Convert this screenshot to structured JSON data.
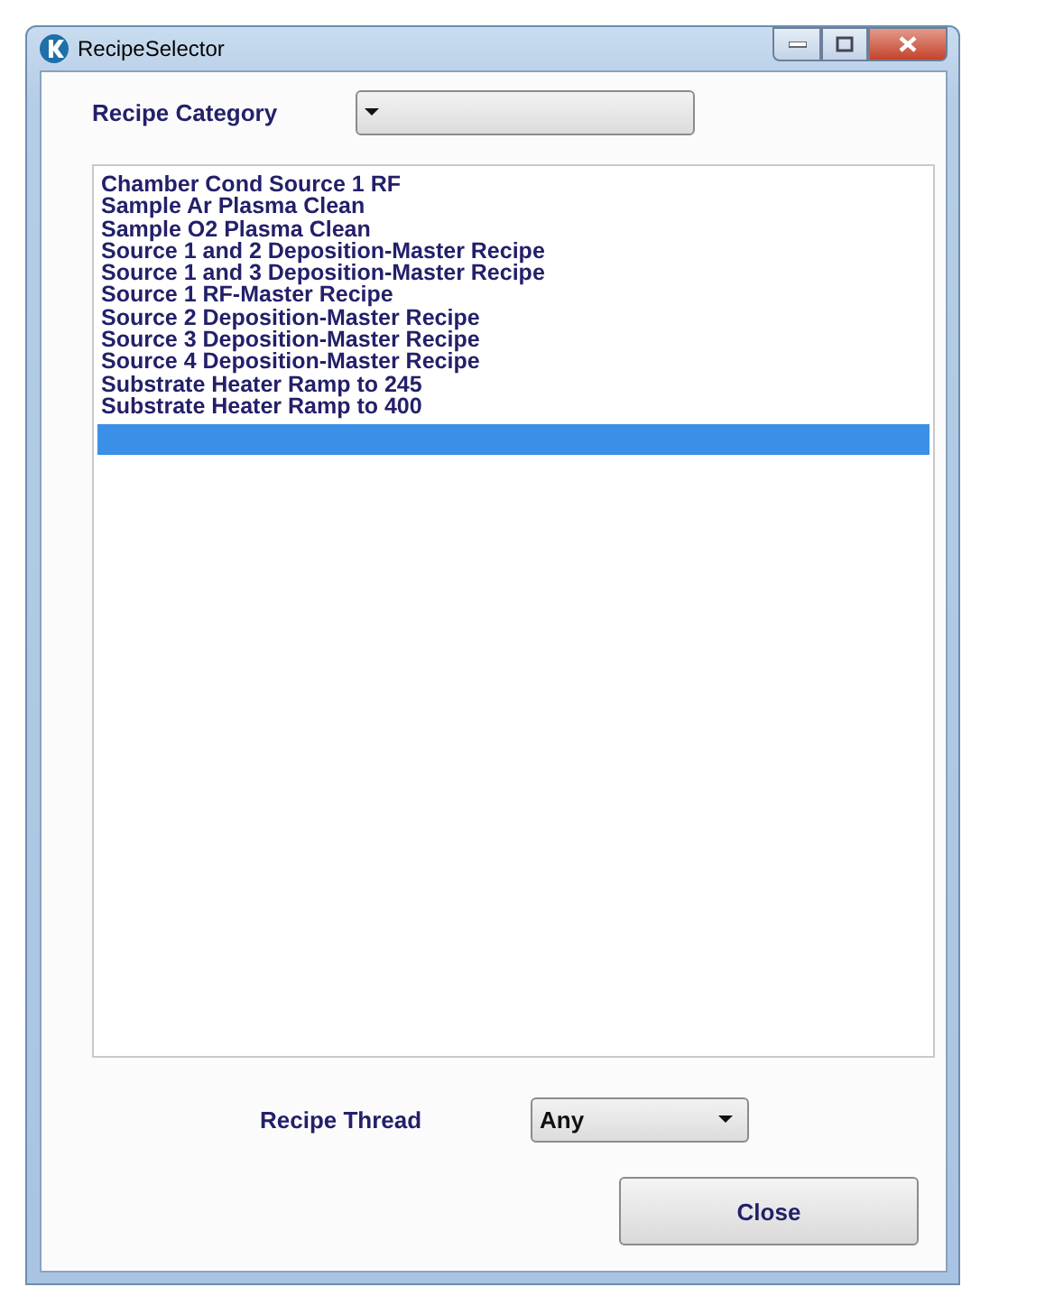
{
  "window": {
    "title": "RecipeSelector"
  },
  "recipe_category": {
    "label": "Recipe Category"
  },
  "recipe_list": {
    "rows": [
      {
        "label": "Chamber Cond Source 1 RF",
        "selected": false
      },
      {
        "label": "Sample Ar Plasma Clean",
        "selected": false
      },
      {
        "label": "Sample O2 Plasma Clean",
        "selected": false
      },
      {
        "label": "Source 1 and 2 Deposition-Master Recipe",
        "selected": false
      },
      {
        "label": "Source 1 and 3 Deposition-Master Recipe",
        "selected": false
      },
      {
        "label": "Source 1 RF-Master Recipe",
        "selected": false
      },
      {
        "label": "Source 2 Deposition-Master Recipe",
        "selected": false
      },
      {
        "label": "Source 3 Deposition-Master Recipe",
        "selected": false
      },
      {
        "label": "Source 4 Deposition-Master Recipe",
        "selected": false
      },
      {
        "label": "Substrate Heater Ramp to 245",
        "selected": false
      },
      {
        "label": "Substrate Heater Ramp to 400",
        "selected": false
      },
      {
        "selected": true
      }
    ]
  },
  "recipe_thread": {
    "label": "Recipe Thread",
    "value": "Any"
  },
  "buttons": [
    "Close"
  ]
}
